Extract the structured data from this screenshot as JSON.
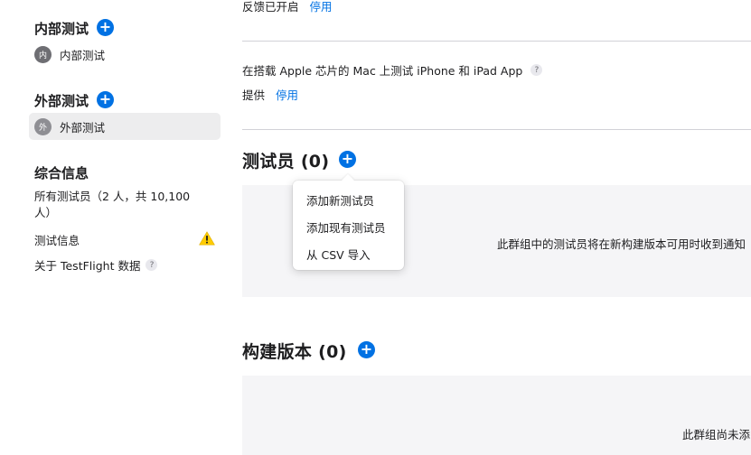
{
  "sidebar": {
    "internal": {
      "heading": "内部测试",
      "item_avatar": "内",
      "item_label": "内部测试"
    },
    "external": {
      "heading": "外部测试",
      "item_avatar": "外",
      "item_label": "外部测试"
    },
    "general": {
      "heading": "综合信息",
      "all_testers": "所有测试员（2 人，共 10,100 人）",
      "test_info": "测试信息",
      "about_testflight": "关于 TestFlight 数据",
      "help_glyph": "?"
    }
  },
  "main": {
    "feedback_status": "反馈已开启",
    "feedback_action": "停用",
    "mac_testing_label": "在搭载 Apple 芯片的 Mac 上测试 iPhone 和 iPad App",
    "help_glyph": "?",
    "mac_testing_status": "提供",
    "mac_testing_action": "停用",
    "testers": {
      "title": "测试员 (0)",
      "empty_text": "此群组中的测试员将在新构建版本可用时收到通知"
    },
    "builds": {
      "title": "构建版本 (0)",
      "empty_text": "此群组尚未添"
    }
  },
  "add_menu": {
    "items": [
      "添加新测试员",
      "添加现有测试员",
      "从 CSV 导入"
    ]
  },
  "colors": {
    "accent": "#0071e3",
    "warning": "#ffcc00",
    "panel": "#f5f5f7"
  },
  "icons": {
    "plus": "+"
  }
}
